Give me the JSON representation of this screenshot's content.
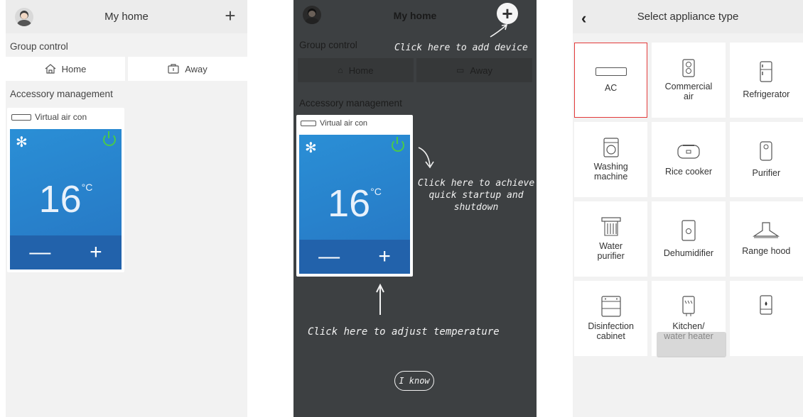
{
  "screen1": {
    "title": "My home",
    "group_control_title": "Group control",
    "home_label": "Home",
    "away_label": "Away",
    "accessory_title": "Accessory management",
    "device_name": "Virtual air con",
    "temperature": "16",
    "unit": "°C",
    "minus": "—",
    "plus": "+"
  },
  "screen2": {
    "title": "My home",
    "group_control_title": "Group control",
    "home_label": "Home",
    "away_label": "Away",
    "accessory_title": "Accessory management",
    "device_name": "Virtual air con",
    "temperature": "16",
    "unit": "°C",
    "minus": "—",
    "plus": "+",
    "tip_add_device": "Click here to add device",
    "tip_power_line1": "Click here to achieve",
    "tip_power_line2": "quick startup and",
    "tip_power_line3": "shutdown",
    "tip_temperature": "Click here to adjust temperature",
    "i_know": "I know"
  },
  "screen3": {
    "title": "Select appliance type",
    "appliances": [
      {
        "label": "AC",
        "icon": "ac-icon"
      },
      {
        "label": "Commercial\nair",
        "icon": "commercial-air-icon"
      },
      {
        "label": "Refrigerator",
        "icon": "refrigerator-icon"
      },
      {
        "label": "Washing\nmachine",
        "icon": "washing-machine-icon"
      },
      {
        "label": "Rice cooker",
        "icon": "rice-cooker-icon"
      },
      {
        "label": "Purifier",
        "icon": "purifier-icon"
      },
      {
        "label": "Water\npurifier",
        "icon": "water-purifier-icon"
      },
      {
        "label": "Dehumidifier",
        "icon": "dehumidifier-icon"
      },
      {
        "label": "Range hood",
        "icon": "range-hood-icon"
      },
      {
        "label": "Disinfection\ncabinet",
        "icon": "disinfection-cabinet-icon"
      },
      {
        "label": "Kitchen/\nwater heater",
        "icon": "water-heater-icon"
      },
      {
        "label": "",
        "icon": "water-dispenser-icon"
      }
    ]
  },
  "colors": {
    "panel_blue": "#2a8fd6",
    "power_green": "#49c94a",
    "overlay_bg": "#3d4042",
    "selected_border": "#e33a3a"
  }
}
